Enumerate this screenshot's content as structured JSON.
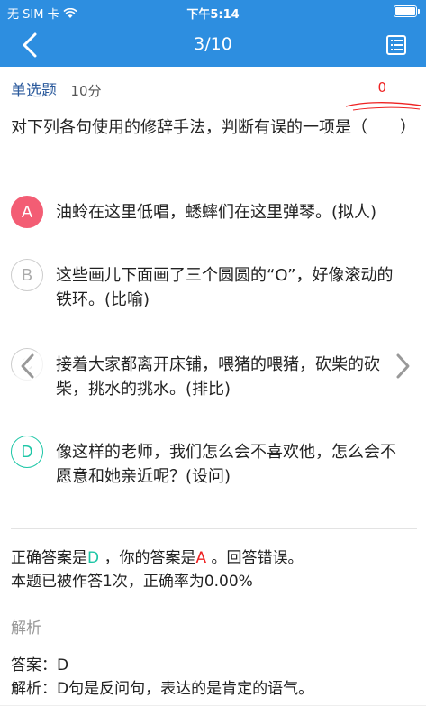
{
  "status_bar": {
    "carrier": "无 SIM 卡",
    "time": "下午5:14"
  },
  "nav": {
    "title": "3/10",
    "back_icon": "chevron-left-icon",
    "menu_icon": "list-icon"
  },
  "question": {
    "type": "单选题",
    "score": "10分",
    "counter": "0",
    "stem": "对下列各句使用的修辞手法，判断有误的一项是（　　）",
    "options": [
      {
        "letter": "A",
        "text": "油蛉在这里低唱，蟋蟀们在这里弹琴。(拟人)",
        "state": "wrong"
      },
      {
        "letter": "B",
        "text": "这些画儿下面画了三个圆圆的“O”，好像滚动的铁环。(比喻)",
        "state": "normal"
      },
      {
        "letter": "C",
        "text": "接着大家都离开床铺，喂猪的喂猪，砍柴的砍柴，挑水的挑水。(排比)",
        "state": "normal"
      },
      {
        "letter": "D",
        "text": "像这样的老师，我们怎么会不喜欢他，怎么会不愿意和她亲近呢？(设问)",
        "state": "right"
      }
    ]
  },
  "result": {
    "prefix": "正确答案是",
    "correct": "D",
    "mid": "，你的答案是",
    "yours": "A",
    "suffix": "。回答错误。",
    "stats": "本题已被作答1次，正确率为0.00%"
  },
  "analysis": {
    "heading": "解析",
    "answer_label": "答案：",
    "answer_value": "D",
    "explain_label": "解析：",
    "explain_value": "D句是反问句，表达的是肯定的语气。"
  },
  "colors": {
    "header": "#2d8ee0",
    "wrong": "#f35d74",
    "right": "#1dc6a6",
    "counter_red": "#e22222"
  }
}
